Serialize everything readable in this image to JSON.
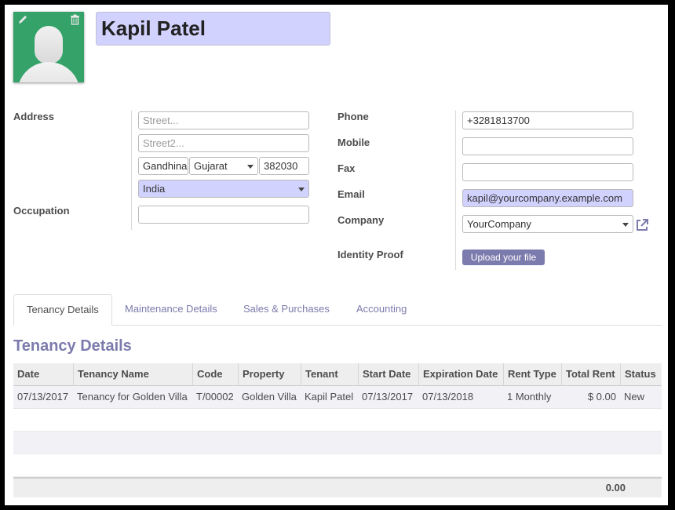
{
  "partner": {
    "name": "Kapil Patel"
  },
  "avatar": {
    "edit_icon": "pencil-icon",
    "delete_icon": "trash-icon"
  },
  "left_form": {
    "address_label": "Address",
    "street_placeholder": "Street...",
    "street2_placeholder": "Street2...",
    "city": "Gandhinagar",
    "state": "Gujarat",
    "zip": "382030",
    "country": "India",
    "occupation_label": "Occupation",
    "occupation": ""
  },
  "right_form": {
    "phone_label": "Phone",
    "phone": "+3281813700",
    "mobile_label": "Mobile",
    "mobile": "",
    "fax_label": "Fax",
    "fax": "",
    "email_label": "Email",
    "email": "kapil@yourcompany.example.com",
    "company_label": "Company",
    "company": "YourCompany",
    "identity_label": "Identity Proof",
    "upload_label": "Upload your file"
  },
  "tabs": [
    {
      "label": "Tenancy Details",
      "active": true
    },
    {
      "label": "Maintenance Details",
      "active": false
    },
    {
      "label": "Sales & Purchases",
      "active": false
    },
    {
      "label": "Accounting",
      "active": false
    }
  ],
  "section_title": "Tenancy Details",
  "table": {
    "headers": [
      "Date",
      "Tenancy Name",
      "Code",
      "Property",
      "Tenant",
      "Start Date",
      "Expiration Date",
      "Rent Type",
      "Total Rent",
      "Status"
    ],
    "rows": [
      [
        "07/13/2017",
        "Tenancy for Golden Villa",
        "T/00002",
        "Golden Villa",
        "Kapil Patel",
        "07/13/2017",
        "07/13/2018",
        "1 Monthly",
        "$ 0.00",
        "New"
      ]
    ],
    "footer_total": "0.00"
  },
  "colors": {
    "accent": "#7c7bad",
    "required_field": "#d2d2ff",
    "avatar_bg": "#35a369"
  }
}
